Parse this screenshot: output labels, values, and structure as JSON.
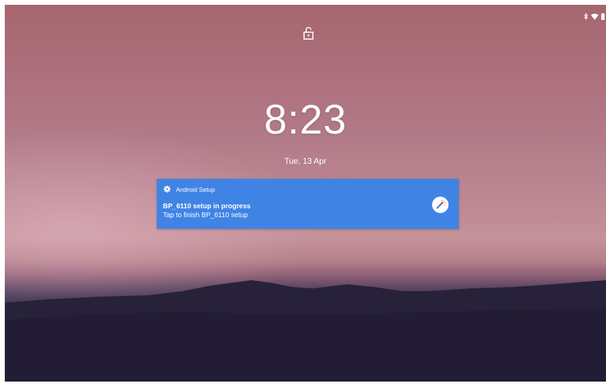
{
  "status_bar": {
    "icons": [
      "bluetooth-icon",
      "wifi-icon",
      "battery-icon"
    ]
  },
  "lock_screen": {
    "lock_icon": "unlocked-padlock-icon",
    "time": "8:23",
    "date": "Tue, 13 Apr"
  },
  "notification": {
    "app_name": "Android Setup",
    "app_icon": "gear-icon",
    "title": "BP_6110 setup in progress",
    "text": "Tap to finish BP_6110 setup",
    "large_icon": "magic-wand-icon",
    "color": "#3f84e5"
  }
}
